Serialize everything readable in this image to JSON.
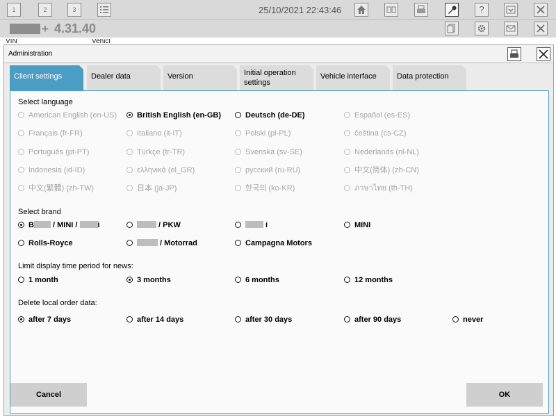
{
  "topbar": {
    "tabs": [
      "1",
      "2",
      "3"
    ],
    "datetime": "25/10/2021 22:43:46",
    "icons": [
      "list-icon",
      "home-icon",
      "split-view-icon",
      "print-icon",
      "wrench-icon",
      "help-icon",
      "download-icon",
      "close-icon"
    ]
  },
  "secondbar": {
    "plus": "+",
    "version": "4.31.40",
    "vin_label": "VIN",
    "vehicle_label": "Vehicl",
    "icons": [
      "document-icon",
      "gear-icon",
      "mail-icon",
      "close-icon"
    ]
  },
  "dialog": {
    "title": "Administration",
    "tabs": [
      {
        "label": "Client settings"
      },
      {
        "label": "Dealer data"
      },
      {
        "label": "Version"
      },
      {
        "label": "Initial operation settings"
      },
      {
        "label": "Vehicle interface"
      },
      {
        "label": "Data protection"
      }
    ],
    "active_tab": "Client settings",
    "language": {
      "heading": "Select language",
      "selected": "British English (en-GB)",
      "options": [
        "American English (en-US)",
        "British English (en-GB)",
        "Deutsch (de-DE)",
        "Español (es-ES)",
        "Français (fr-FR)",
        "Italiano (it-IT)",
        "Polski (pl-PL)",
        "čeština (cs-CZ)",
        "Português (pt-PT)",
        "Türkçe (tr-TR)",
        "Svenska (sv-SE)",
        "Nederlands (nl-NL)",
        "Indonesia (id-ID)",
        "ελληνικά (el_GR)",
        "русский (ru-RU)",
        "中文(简体) (zh-CN)",
        "中文(繁體) (zh-TW)",
        "日本 (ja-JP)",
        "한국의 (ko-KR)",
        "ภาษาไทย (th-TH)"
      ]
    },
    "brand": {
      "heading": "Select brand",
      "selected": "B / MINI / i",
      "options": [
        {
          "pre": "B",
          "post": " / MINI / ",
          "tail": "i"
        },
        {
          "pre": "",
          "post": " / PKW",
          "tail": ""
        },
        {
          "pre": "",
          "post": "",
          "tail": " i"
        },
        {
          "pre": "MINI",
          "post": "",
          "tail": ""
        },
        {
          "pre": "Rolls-Royce",
          "post": "",
          "tail": ""
        },
        {
          "pre": "",
          "post": " / Motorrad",
          "tail": ""
        },
        {
          "pre": "Campagna Motors",
          "post": "",
          "tail": ""
        }
      ]
    },
    "news_period": {
      "heading": "Limit display time period for news:",
      "selected": "3 months",
      "options": [
        "1 month",
        "3 months",
        "6 months",
        "12 months"
      ]
    },
    "delete_orders": {
      "heading": "Delete local order data:",
      "selected": "after 7 days",
      "options": [
        "after 7 days",
        "after 14 days",
        "after 30 days",
        "after 90 days",
        "never"
      ]
    },
    "buttons": {
      "cancel": "Cancel",
      "ok": "OK"
    }
  }
}
